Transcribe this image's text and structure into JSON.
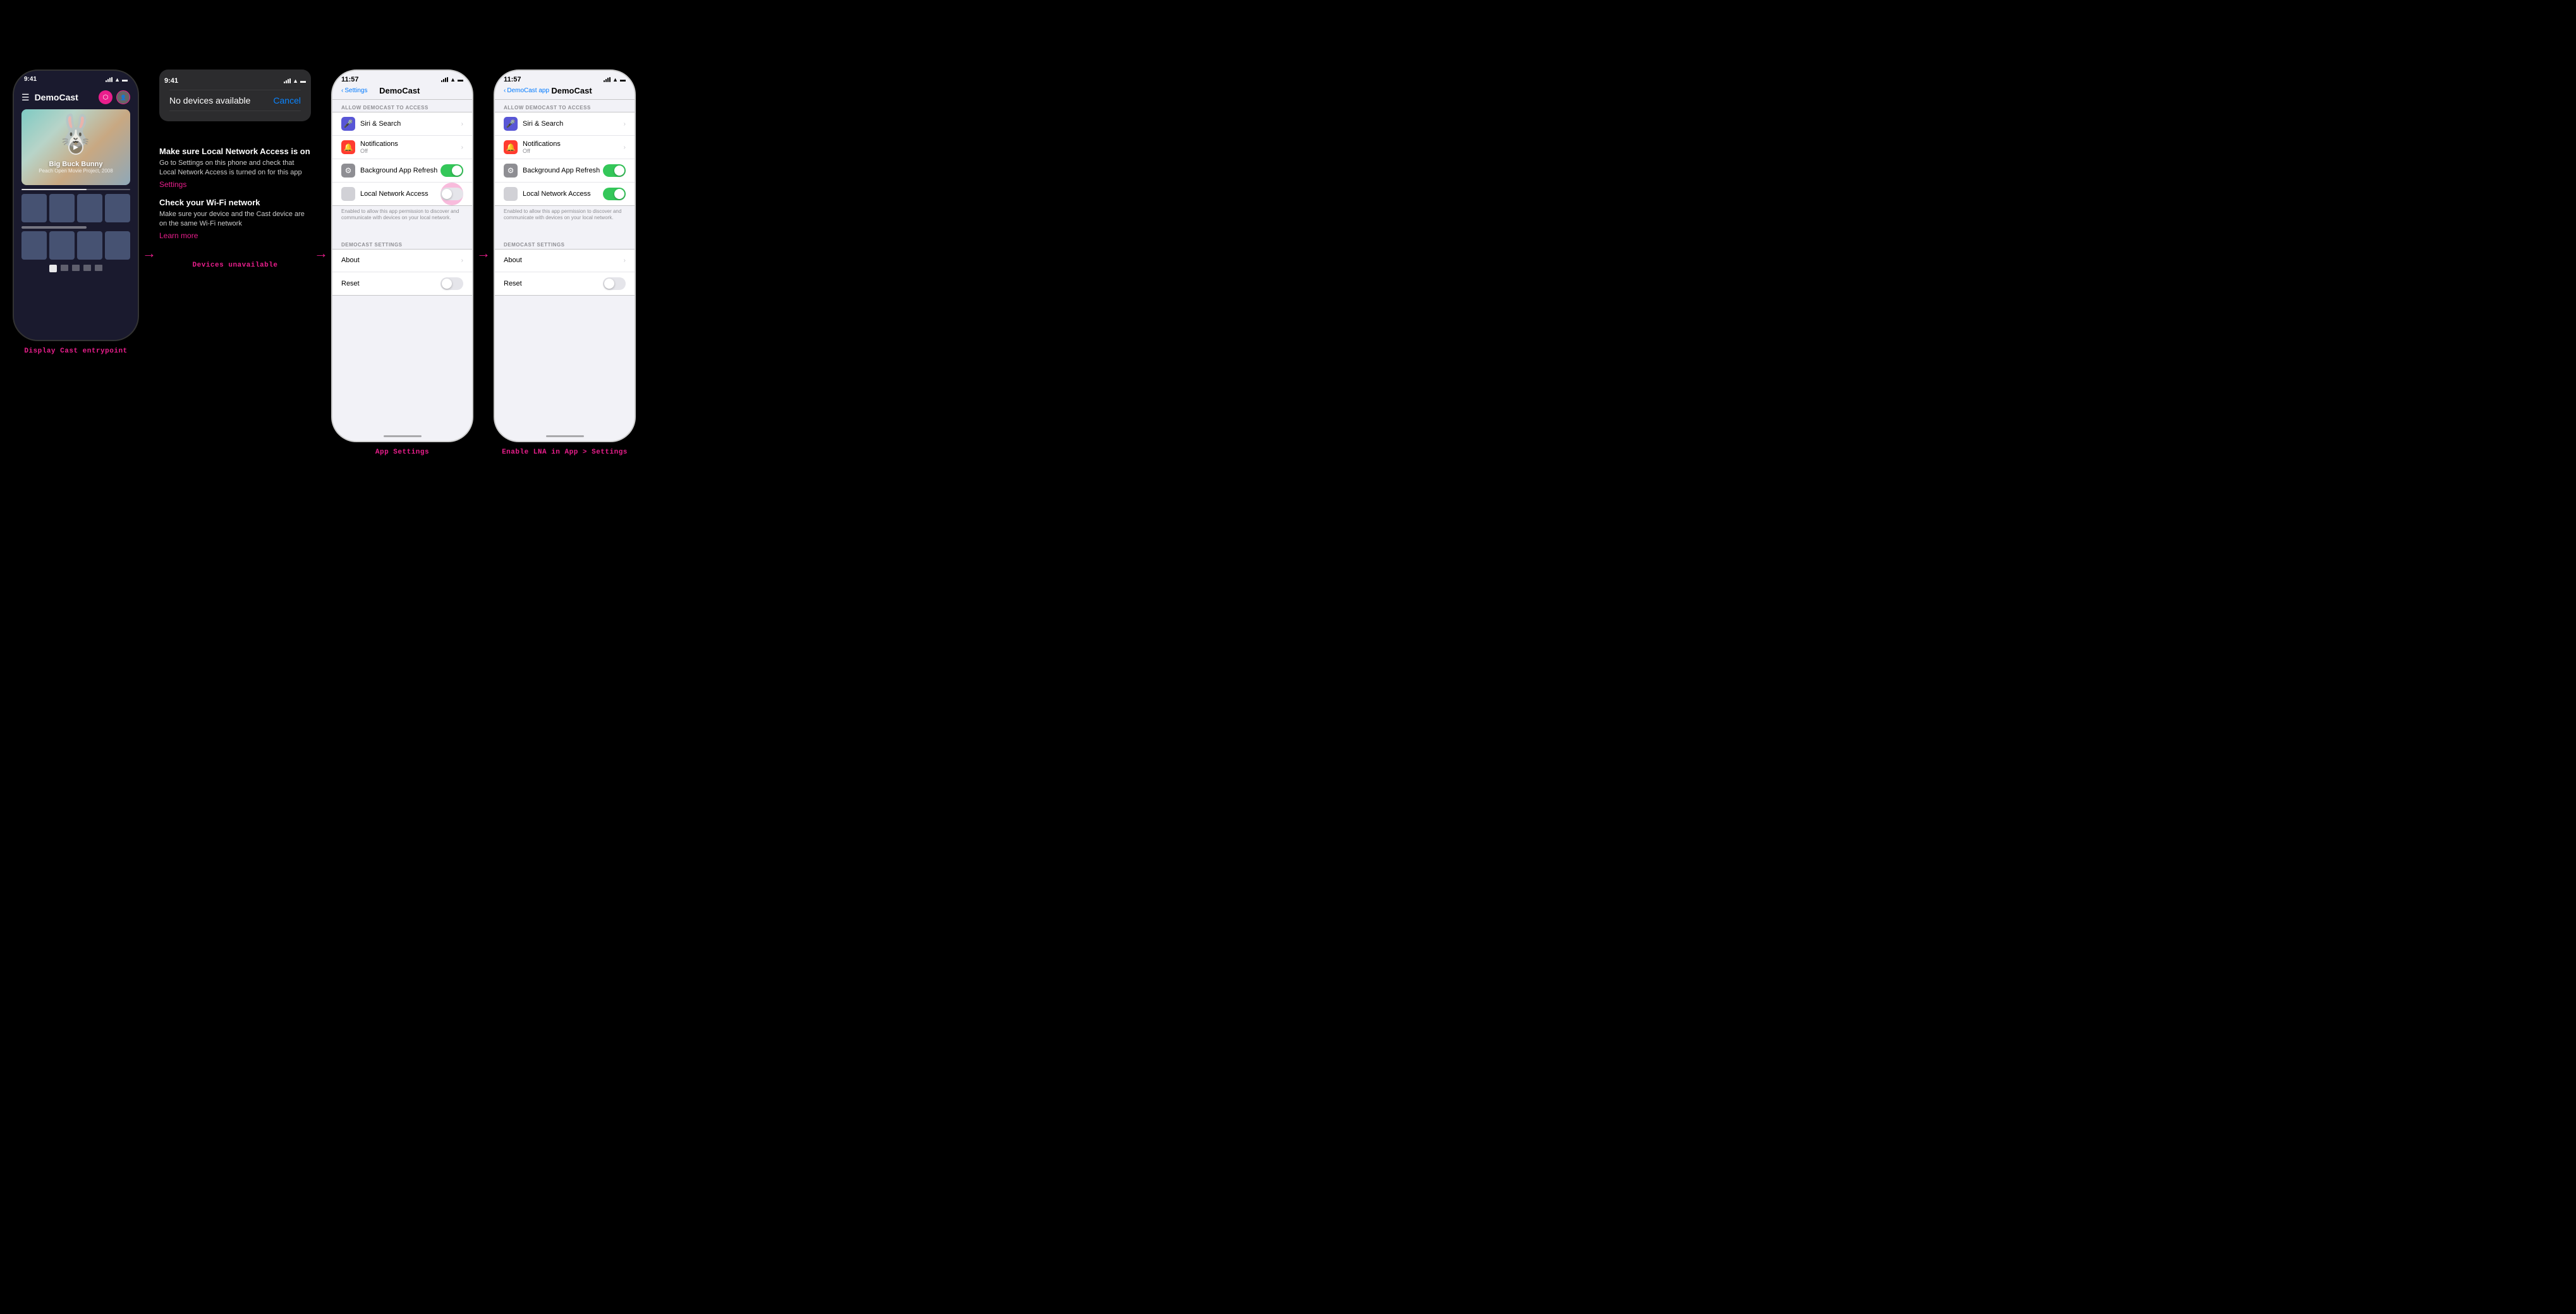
{
  "screen1": {
    "time": "9:41",
    "app_title": "DemoCast",
    "hero_title": "Big Buck Bunny",
    "hero_subtitle": "Peach Open Movie Project, 2008",
    "caption": "Display Cast entrypoint"
  },
  "screen2": {
    "time": "9:41",
    "no_devices_title": "No devices available",
    "cancel_label": "Cancel",
    "instruction1_title": "Make sure Local Network Access is on",
    "instruction1_text": "Go to Settings on this phone and check that Local Network Access is turned on for this app",
    "instruction1_link": "Settings",
    "instruction2_title": "Check your Wi-Fi network",
    "instruction2_text": "Make sure your device and the Cast device are on the same Wi-Fi network",
    "instruction2_link": "Learn more",
    "caption": "Devices unavailable"
  },
  "screen3": {
    "time": "11:57",
    "back_label": "Settings",
    "page_title": "DemoCast",
    "section1_header": "Allow DemoCast to Access",
    "siri_label": "Siri & Search",
    "notifications_label": "Notifications",
    "notifications_sub": "Off",
    "bg_refresh_label": "Background App Refresh",
    "bg_refresh_on": true,
    "lna_label": "Local Network Access",
    "lna_note": "Enabled to allow this app permission to discover and communicate with devices on your local network.",
    "section2_header": "DemoCast Settings",
    "about_label": "About",
    "reset_label": "Reset",
    "reset_on": false,
    "caption": "App Settings",
    "lna_pulsing": true
  },
  "screen4": {
    "time": "11:57",
    "back_label": "DemoCast app",
    "page_title": "DemoCast",
    "section1_header": "Allow DemoCast to Access",
    "siri_label": "Siri & Search",
    "notifications_label": "Notifications",
    "notifications_sub": "Off",
    "bg_refresh_label": "Background App Refresh",
    "bg_refresh_on": true,
    "lna_label": "Local Network Access",
    "lna_on": true,
    "lna_note": "Enabled to allow this app permission to discover and communicate with devices on your local network.",
    "section2_header": "DemoCast Settings",
    "about_label": "About",
    "reset_label": "Reset",
    "reset_on": false,
    "caption": "Enable LNA in App > Settings"
  },
  "arrows": {
    "right": "→"
  }
}
